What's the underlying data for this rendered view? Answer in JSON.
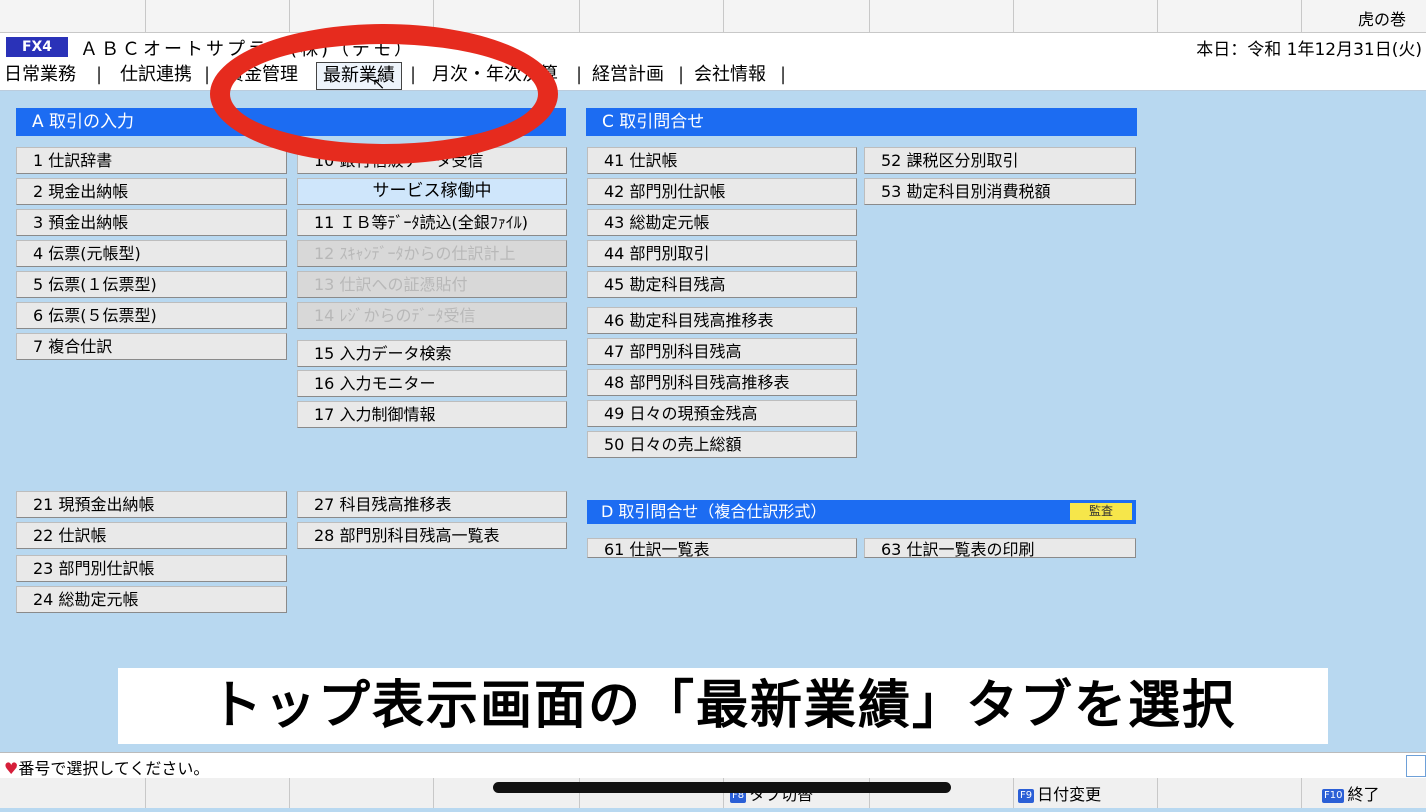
{
  "topbar": {
    "right_label": "虎の巻"
  },
  "title": {
    "badge": "FX4",
    "company": "ＡＢＣオートサプライ(株)（デモ）",
    "today": "本日：令和 1年12月31日(火)"
  },
  "menu": {
    "items": [
      "日常業務",
      "仕訳連携",
      "資金管理",
      "最新業績",
      "月次・年次決算",
      "経営計画",
      "会社情報"
    ],
    "separator": "|"
  },
  "sections": {
    "a_header": "A 取引の入力",
    "c_header": "C 取引問合せ",
    "d_header": "D 取引問合せ（複合仕訳形式）",
    "d_badge": "監査"
  },
  "col1": [
    "1 仕訳辞書",
    "2 現金出納帳",
    "3 預金出納帳",
    "4 伝票(元帳型)",
    "5 伝票(１伝票型)",
    "6 伝票(５伝票型)",
    "7 複合仕訳"
  ],
  "col2": {
    "bank": "10 銀行信販データ受信",
    "service": "サービス稼働中",
    "ib": "11 ＩＢ等ﾃﾞｰﾀ読込(全銀ﾌｧｲﾙ)",
    "scan": "12 ｽｷｬﾝﾃﾞｰﾀからの仕訳計上",
    "evidence": "13 仕訳への証憑貼付",
    "register": "14 ﾚｼﾞからのﾃﾞｰﾀ受信",
    "search": "15 入力データ検索",
    "monitor": "16 入力モニター",
    "control": "17 入力制御情報"
  },
  "col3": [
    "41 仕訳帳",
    "42 部門別仕訳帳",
    "43 総勘定元帳",
    "44 部門別取引",
    "45 勘定科目残高",
    "46 勘定科目残高推移表",
    "47 部門別科目残高",
    "48 部門別科目残高推移表",
    "49 日々の現預金残高",
    "50 日々の売上総額"
  ],
  "col4": [
    "52 課税区分別取引",
    "53 勘定科目別消費税額"
  ],
  "lower_col1": [
    "21 現預金出納帳",
    "22 仕訳帳",
    "23 部門別仕訳帳",
    "24 総勘定元帳"
  ],
  "lower_col2": [
    "27 科目残高推移表",
    "28 部門別科目残高一覧表"
  ],
  "lower_col3": [
    "61 仕訳一覧表",
    "63 仕訳一覧表の印刷"
  ],
  "status": {
    "message": "番号で選択してください。"
  },
  "bottom": {
    "f8_key": "F8",
    "f8_label": "タブ切替",
    "f9_key": "F9",
    "f9_label": "日付変更",
    "f10_key": "F10",
    "f10_label": "終了"
  },
  "caption": "トップ表示画面の「最新業績」タブを選択",
  "colors": {
    "header_blue": "#1c6cf2",
    "background": "#b8d8f0",
    "annotation_red": "#e62b1e"
  }
}
